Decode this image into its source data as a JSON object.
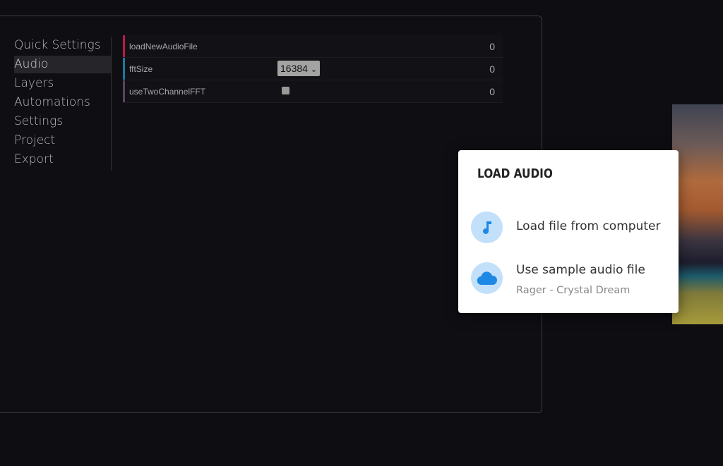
{
  "nav": {
    "items": [
      "Quick Settings",
      "Audio",
      "Layers",
      "Automations",
      "Settings",
      "Project",
      "Export"
    ],
    "active": "Audio"
  },
  "rows": [
    {
      "label": "loadNewAudioFile",
      "value": "0",
      "color": "#c0174a"
    },
    {
      "label": "fftSize",
      "select": "16384",
      "value": "0",
      "color": "#1a7aa0"
    },
    {
      "label": "useTwoChannelFFT",
      "checked": false,
      "value": "0",
      "color": "#5a4460"
    }
  ],
  "dialog": {
    "title": "LOAD AUDIO",
    "options": [
      {
        "label": "Load file from computer",
        "icon": "music-note-icon"
      },
      {
        "label": "Use sample audio file",
        "sub": "Rager - Crystal Dream",
        "icon": "cloud-icon"
      }
    ]
  },
  "colors": {
    "accent": "#1e88e5",
    "icon_bg": "#c3e0fb"
  }
}
